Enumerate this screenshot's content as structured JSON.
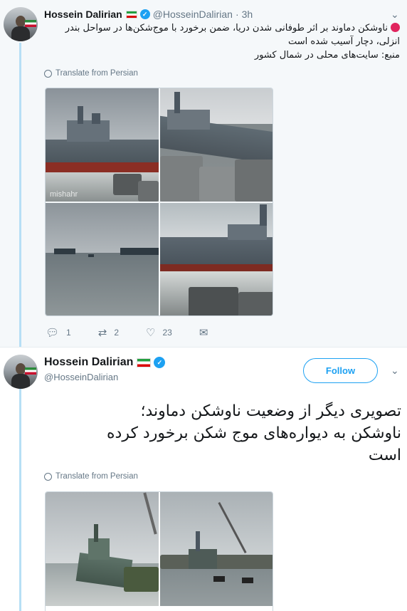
{
  "tweet1": {
    "author_name": "Hossein Dalirian",
    "handle": "@HosseinDalirian",
    "separator": "·",
    "time": "3h",
    "lines": [
      "ناوشکن دماوند بر اثر طوفانی شدن دریا، ضمن برخورد با موج‌شکن‌ها در سواحل بندر",
      "انزلی، دچار آسیب شده است",
      "منبع: سایت‌های محلی در شمال کشور"
    ],
    "translate_label": "Translate from Persian",
    "watermark": "mishahr",
    "actions": {
      "reply_count": "1",
      "retweet_count": "2",
      "like_count": "23"
    }
  },
  "tweet2": {
    "author_name": "Hossein Dalirian",
    "handle": "@HosseinDalirian",
    "follow_label": "Follow",
    "lines": [
      "تصویری دیگر از وضعیت ناوشکن دماوند؛",
      "ناوشکن به دیواره‌های موج شکن برخورد کرده",
      "است"
    ],
    "translate_label": "Translate from Persian"
  },
  "icons": {
    "chevron": "chevron-down-icon",
    "reply": "reply-icon",
    "retweet": "retweet-icon",
    "like": "heart-icon",
    "message": "envelope-icon",
    "globe": "globe-icon",
    "verified": "verified-badge-icon"
  },
  "colors": {
    "accent": "#1da1f2",
    "thread_line": "#b7dff5",
    "muted": "#657786",
    "red_dot": "#e0245e"
  }
}
